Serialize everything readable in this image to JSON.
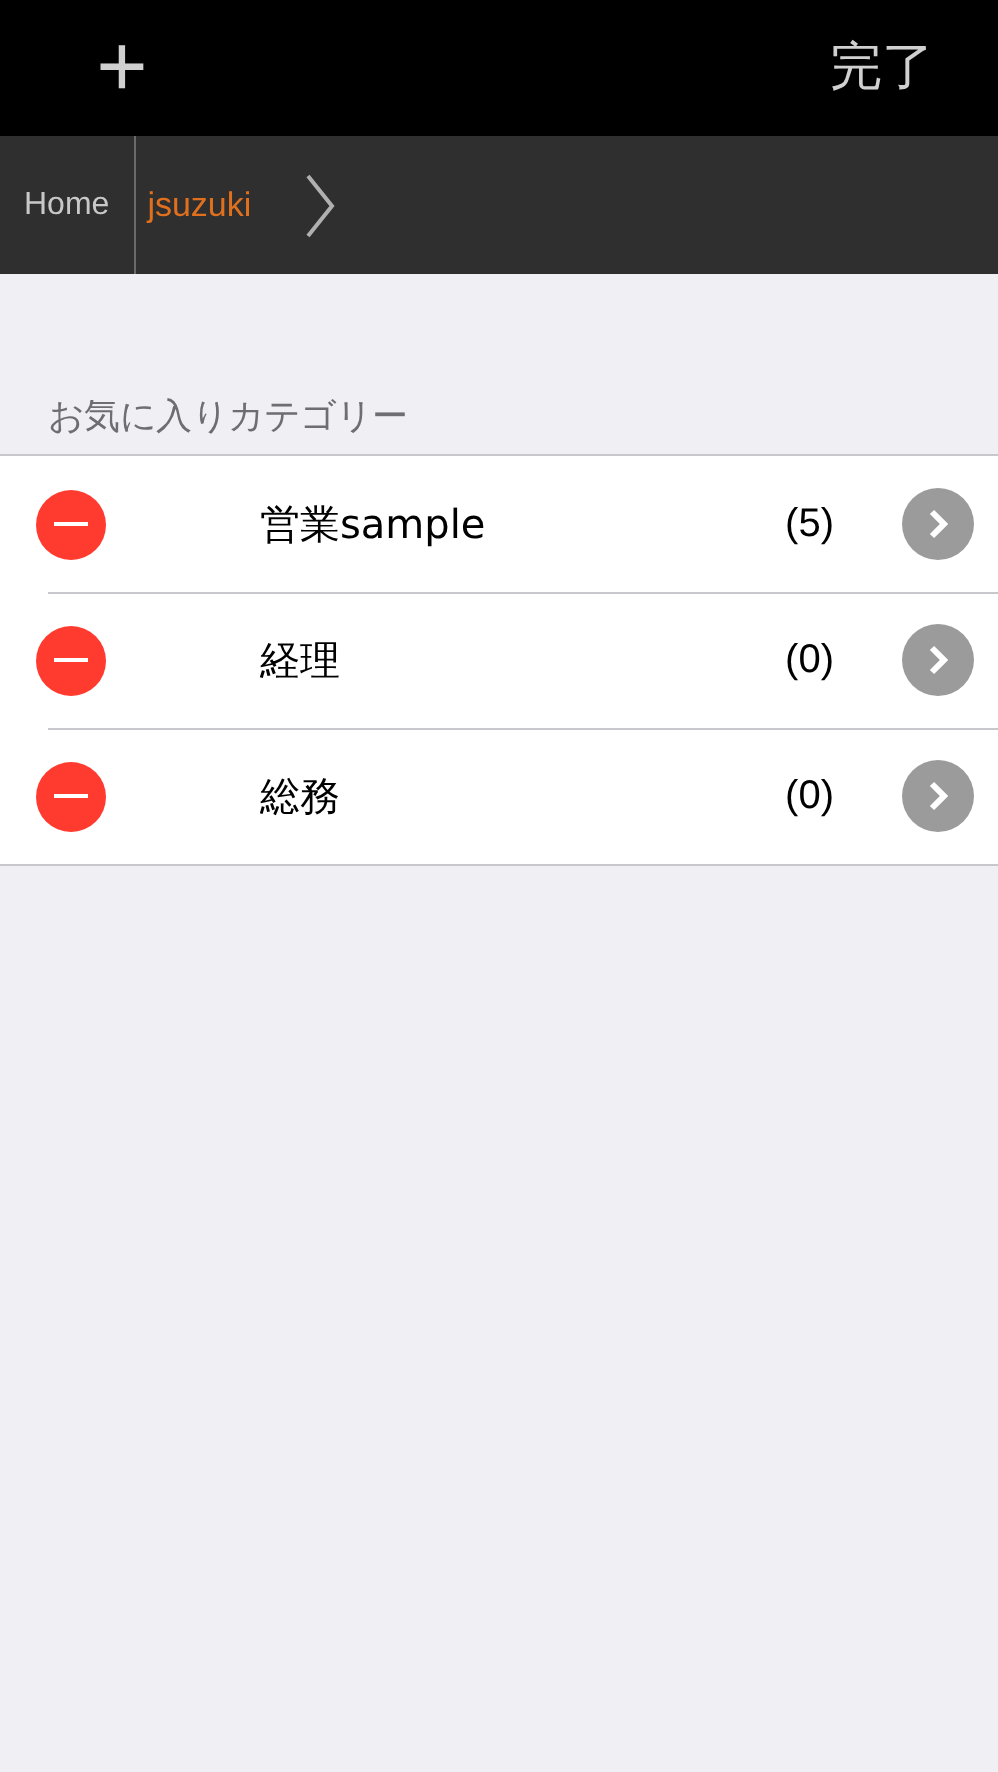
{
  "nav_bar": {
    "add_glyph": "+",
    "done": "完了"
  },
  "breadcrumb": {
    "items": [
      {
        "label": "Home",
        "selected": false
      },
      {
        "label": "jsuzuki",
        "selected": true
      }
    ]
  },
  "section": {
    "header": "お気に入りカテゴリー",
    "rows": [
      {
        "name": "営業sample",
        "count": "(5)"
      },
      {
        "name": "経理",
        "count": "(0)"
      },
      {
        "name": "総務",
        "count": "(0)"
      }
    ]
  }
}
